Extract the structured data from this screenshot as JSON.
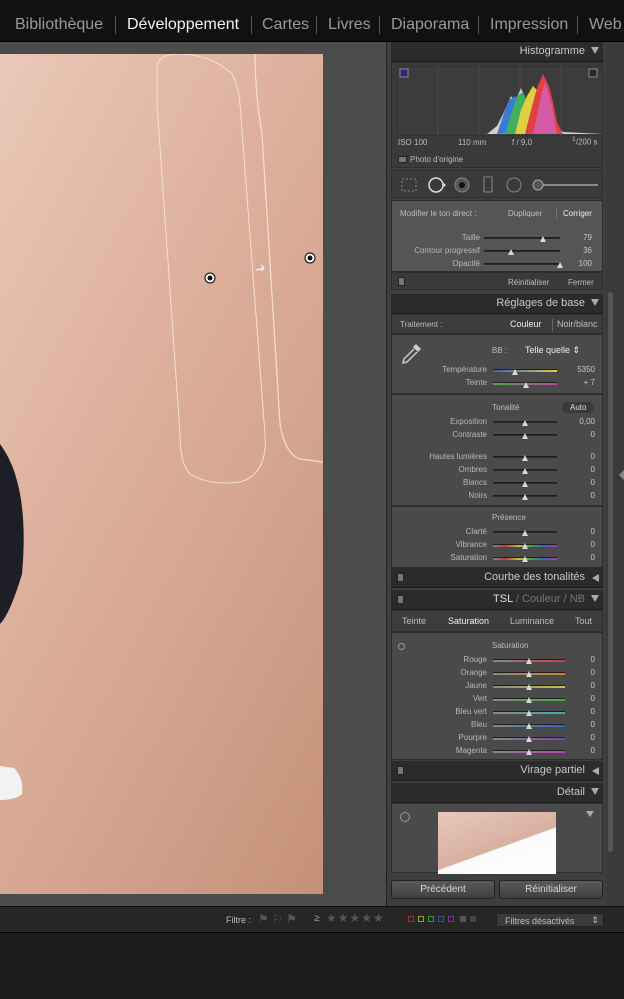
{
  "modules": [
    "Bibliothèque",
    "Développement",
    "Cartes",
    "Livres",
    "Diaporama",
    "Impression",
    "Web"
  ],
  "active_module": "Développement",
  "histogram": {
    "title": "Histogramme",
    "iso": "ISO 100",
    "focal": "110 mm",
    "aperture": "f / 9,0",
    "shutter_num": "1",
    "shutter_den": "200",
    "shutter_unit": "s",
    "original_photo": "Photo d'origine"
  },
  "brush": {
    "edit_label": "Modifier le ton direct :",
    "duplicate": "Dupliquer",
    "correct": "Corriger",
    "sliders": [
      {
        "label": "Taille",
        "value": "79",
        "pos": 0.78
      },
      {
        "label": "Contour progressif",
        "value": "36",
        "pos": 0.36
      },
      {
        "label": "Opacité",
        "value": "100",
        "pos": 1.0
      }
    ],
    "reset": "Réinitialiser",
    "close": "Fermer"
  },
  "basic": {
    "title": "Réglages de base",
    "treatment_label": "Traitement :",
    "color": "Couleur",
    "bw": "Noir/blanc",
    "wb_label": "BB :",
    "wb_value": "Telle quelle",
    "temp": {
      "label": "Température",
      "value": "5350",
      "pos": 0.35
    },
    "tint": {
      "label": "Teinte",
      "value": "+ 7",
      "pos": 0.52
    },
    "tone_title": "Tonalité",
    "auto": "Auto",
    "tone": [
      {
        "label": "Exposition",
        "value": "0,00",
        "pos": 0.5
      },
      {
        "label": "Contraste",
        "value": "0",
        "pos": 0.5
      }
    ],
    "tone2": [
      {
        "label": "Hautes lumières",
        "value": "0",
        "pos": 0.5
      },
      {
        "label": "Ombres",
        "value": "0",
        "pos": 0.5
      },
      {
        "label": "Blancs",
        "value": "0",
        "pos": 0.5
      },
      {
        "label": "Noirs",
        "value": "0",
        "pos": 0.5
      }
    ],
    "presence_title": "Présence",
    "presence": [
      {
        "label": "Clarté",
        "value": "0",
        "pos": 0.5
      },
      {
        "label": "Vibrance",
        "value": "0",
        "pos": 0.5
      },
      {
        "label": "Saturation",
        "value": "0",
        "pos": 0.5
      }
    ]
  },
  "tone_curve": {
    "title": "Courbe des tonalités"
  },
  "hsl": {
    "tsl": "TSL",
    "sep": "/",
    "couleur": "Couleur",
    "nb": "NB",
    "tabs": [
      "Teinte",
      "Saturation",
      "Luminance",
      "Tout"
    ],
    "active_tab": "Saturation",
    "section": "Saturation",
    "rows": [
      {
        "label": "Rouge",
        "value": "0",
        "color": "#c84040"
      },
      {
        "label": "Orange",
        "value": "0",
        "color": "#d08030"
      },
      {
        "label": "Jaune",
        "value": "0",
        "color": "#c8c040"
      },
      {
        "label": "Vert",
        "value": "0",
        "color": "#40b040"
      },
      {
        "label": "Bleu vert",
        "value": "0",
        "color": "#30b0b0"
      },
      {
        "label": "Bleu",
        "value": "0",
        "color": "#3060d0"
      },
      {
        "label": "Pourpre",
        "value": "0",
        "color": "#8040c0"
      },
      {
        "label": "Magenta",
        "value": "0",
        "color": "#c040b0"
      }
    ]
  },
  "split": {
    "title": "Virage partiel"
  },
  "detail": {
    "title": "Détail"
  },
  "bottom": {
    "previous": "Précédent",
    "reset": "Réinitialiser"
  },
  "filter": {
    "label": "Filtre :",
    "ge": "≥",
    "status": "Filtres désactivés"
  }
}
